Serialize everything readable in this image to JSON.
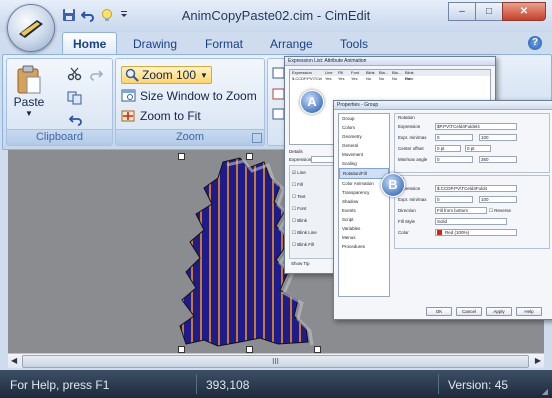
{
  "window": {
    "title": "AnimCopyPaste02.cim - CimEdit",
    "controls": {
      "minimize": "–",
      "maximize": "□",
      "close": "✕"
    }
  },
  "tabs": [
    {
      "label": "Home",
      "active": true
    },
    {
      "label": "Drawing",
      "active": false
    },
    {
      "label": "Format",
      "active": false
    },
    {
      "label": "Arrange",
      "active": false
    },
    {
      "label": "Tools",
      "active": false
    }
  ],
  "ribbon": {
    "clipboard": {
      "label": "Clipboard",
      "paste_label": "Paste"
    },
    "zoom": {
      "label": "Zoom",
      "zoom_value": "Zoom 100",
      "size_window_label": "Size Window to Zoom",
      "zoom_to_fit_label": "Zoom to Fit"
    }
  },
  "callouts": {
    "a": "A",
    "b": "B"
  },
  "scrollbar": {
    "thumb_label": "III"
  },
  "dialog_expression": {
    "title": "Expression List: Attribute Animation",
    "columns": [
      "Expression",
      "Line",
      "Fill",
      "Font",
      "Blink",
      "Bla...",
      "Bla...",
      "Blink Rate"
    ],
    "row": [
      "$.CCDP.PV\\TCeld4...",
      "Yes",
      "Yes",
      "Yes",
      "No",
      "No",
      "No",
      "No"
    ],
    "details_label": "Details",
    "expr_label": "Expression",
    "checkbox_labels": [
      "Line",
      "Fill",
      "Text",
      "Font",
      "Blink",
      "Blink Line",
      "Blink Fill"
    ],
    "overflow_label": "Show Tip"
  },
  "dialog_properties": {
    "title": "Properties - Group",
    "nav": [
      "Group",
      "Colors",
      "Geometry",
      "General",
      "Movement",
      "Scaling",
      "Rotation/Fill",
      "Color Animation",
      "Transparency",
      "Shadow",
      "Events",
      "Script",
      "Variables",
      "Menus",
      "Procedures"
    ],
    "selected_nav": "Rotation/Fill",
    "rotation_section": "Rotation",
    "rotation_fields": [
      {
        "label": "Expression",
        "value": "$P.PV\\TCeld4Fuldel4"
      },
      {
        "label": "Expr. min/max",
        "value": "0",
        "value2": "100"
      },
      {
        "label": "Center offset",
        "value": "0 pt",
        "value2": "0 pt"
      },
      {
        "label": "Min/max angle",
        "value": "0",
        "value2": "360"
      }
    ],
    "fill_section": "Fill",
    "fill_fields": [
      {
        "label": "Expression",
        "value": "$.CCDP.PV\\TCeld4Fuld4"
      },
      {
        "label": "Expr. min/max",
        "value": "0",
        "value2": "100"
      },
      {
        "label": "Direction",
        "value": "Fill from bottom",
        "extra": "Reverse"
      },
      {
        "label": "Fill Style",
        "value": "Solid"
      },
      {
        "label": "Color",
        "value": "Red (100%)"
      }
    ],
    "buttons": [
      "OK",
      "Cancel",
      "Apply",
      "Help"
    ]
  },
  "status": {
    "help_text": "For Help, press F1",
    "coordinates": "393,108",
    "version": "Version: 45"
  },
  "colors": {
    "shape_fill": "#1e1c8c",
    "shape_stripe": "#c87a2c",
    "accent_red": "#d0251a",
    "statusbar": "#27354a"
  }
}
